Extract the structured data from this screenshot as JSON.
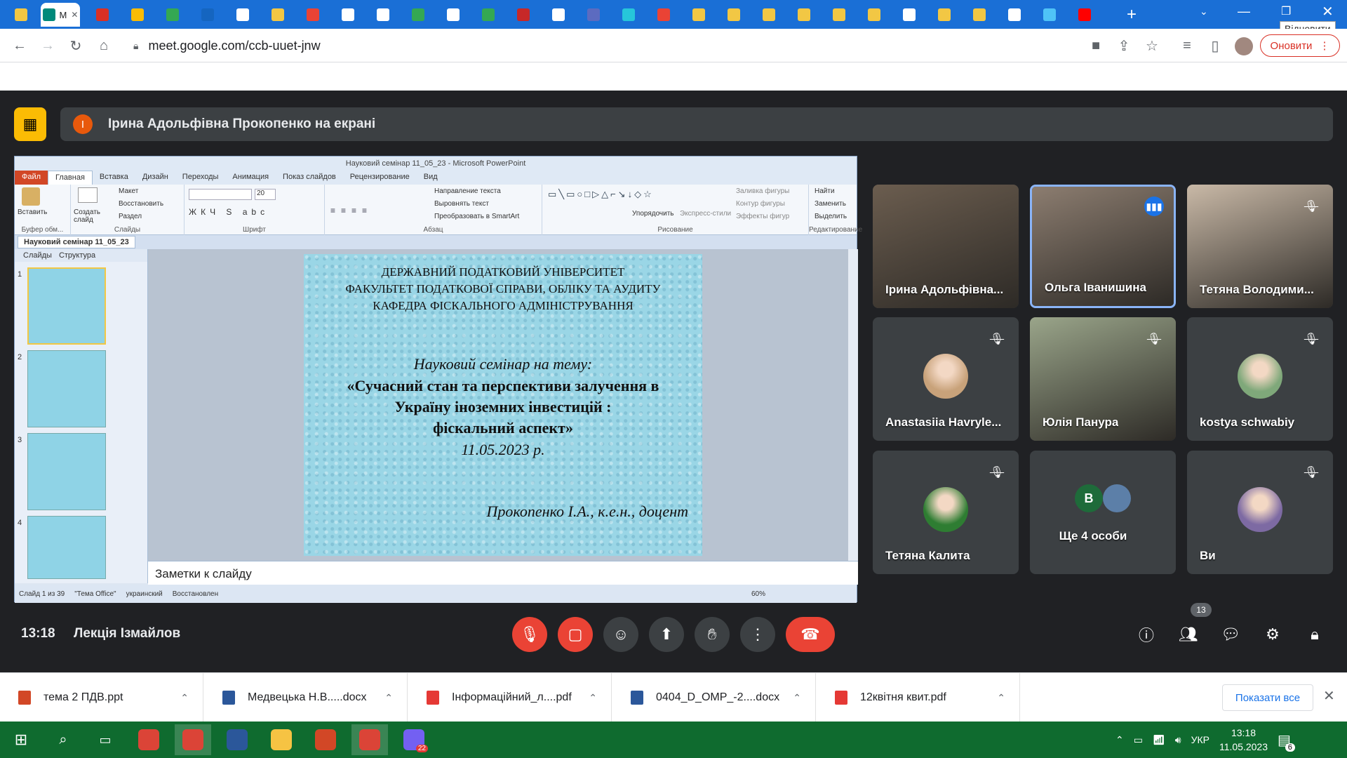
{
  "browser": {
    "tooltip": "Відновити",
    "url": "meet.google.com/ccb-uuet-jnw",
    "update_button": "Оновити",
    "tabs": [
      {
        "icon": "ukraine-crest-icon",
        "color": "#f2c744"
      },
      {
        "icon": "meet-icon",
        "color": "#00897b",
        "active": true,
        "title": "M"
      },
      {
        "icon": "globe-icon",
        "color": "#d93025"
      },
      {
        "icon": "doc-icon",
        "color": "#fbbc04"
      },
      {
        "icon": "image-icon",
        "color": "#34a853"
      },
      {
        "icon": "flag-icon",
        "color": "#1565c0"
      },
      {
        "icon": "doc-icon",
        "color": "#ffffff"
      },
      {
        "icon": "ukraine-crest-icon",
        "color": "#f2c744"
      },
      {
        "icon": "gmail-icon",
        "color": "#ea4335"
      },
      {
        "icon": "zoom-z-icon",
        "color": "#ffffff"
      },
      {
        "icon": "zoom-z-icon",
        "color": "#ffffff"
      },
      {
        "icon": "chrome-icon",
        "color": "#34a853"
      },
      {
        "icon": "zoom-z-icon",
        "color": "#ffffff"
      },
      {
        "icon": "maps-icon",
        "color": "#34a853"
      },
      {
        "icon": "shield-icon",
        "color": "#c62828"
      },
      {
        "icon": "facebook-icon",
        "color": "#ffffff"
      },
      {
        "icon": "globe-icon",
        "color": "#5c6bc0"
      },
      {
        "icon": "circle-icon",
        "color": "#26c6da"
      },
      {
        "icon": "gmail-icon",
        "color": "#ea4335"
      },
      {
        "icon": "ukraine-crest-icon",
        "color": "#f2c744"
      },
      {
        "icon": "check-icon",
        "color": "#f2c744"
      },
      {
        "icon": "ukraine-crest-icon",
        "color": "#f2c744"
      },
      {
        "icon": "ukraine-crest-icon",
        "color": "#f2c744"
      },
      {
        "icon": "ukraine-crest-icon",
        "color": "#f2c744"
      },
      {
        "icon": "ukraine-crest-icon",
        "color": "#f2c744"
      },
      {
        "icon": "notion-icon",
        "color": "#ffffff"
      },
      {
        "icon": "ukraine-crest-icon",
        "color": "#f2c744"
      },
      {
        "icon": "ukraine-crest-icon",
        "color": "#f2c744"
      },
      {
        "icon": "chart-icon",
        "color": "#ffffff"
      },
      {
        "icon": "star-icon",
        "color": "#4fc3f7"
      },
      {
        "icon": "youtube-icon",
        "color": "#ff0000"
      }
    ]
  },
  "presentation": {
    "presenter_initial": "І",
    "banner": "Ірина Адольфівна Прокопенко на екрані"
  },
  "ppt": {
    "window_title": "Науковий семінар 11_05_23 - Microsoft PowerPoint",
    "menu": [
      "Файл",
      "Главная",
      "Вставка",
      "Дизайн",
      "Переходы",
      "Анимация",
      "Показ слайдов",
      "Рецензирование",
      "Вид"
    ],
    "ribbon": {
      "paste": "Вставить",
      "new_slide": "Создать слайд",
      "layout": "Макет",
      "reset": "Восстановить",
      "section": "Раздел",
      "font_size": "20",
      "text_direction": "Направление текста",
      "align_text": "Выровнять текст",
      "smartart": "Преобразовать в SmartArt",
      "arrange": "Упорядочить",
      "quick_styles": "Экспресс-стили",
      "shape_fill": "Заливка фигуры",
      "shape_outline": "Контур фигуры",
      "shape_effects": "Эффекты фигур",
      "find": "Найти",
      "replace": "Заменить",
      "select": "Выделить",
      "groups": [
        "Буфер обм...",
        "Слайды",
        "Шрифт",
        "Абзац",
        "Рисование",
        "Редактирование"
      ]
    },
    "doc_tab": "Науковий семінар 11_05_23",
    "pane_tabs": [
      "Слайды",
      "Структура"
    ],
    "thumb_numbers": [
      "1",
      "2",
      "3",
      "4"
    ],
    "slide": {
      "org1": "ДЕРЖАВНИЙ ПОДАТКОВИЙ УНІВЕРСИТЕТ",
      "org2": "ФАКУЛЬТЕТ ПОДАТКОВОЇ СПРАВИ, ОБЛІКУ ТА АУДИТУ",
      "org3": "КАФЕДРА ФІСКАЛЬНОГО АДМІНІСТРУВАННЯ",
      "subtitle": "Науковий семінар на тему:",
      "title1": "«Сучасний стан та перспективи залучення в",
      "title2": "Україну іноземних інвестицій :",
      "title3": "фіскальний аспект»",
      "date": "11.05.2023 р.",
      "author": "Прокопенко І.А., к.е.н., доцент"
    },
    "notes": "Заметки к слайду",
    "status": [
      "Слайд 1 из 39",
      "\"Тема Office\"",
      "украинский",
      "Восстановлен"
    ],
    "zoom": "60%"
  },
  "participants": [
    {
      "name": "Ірина Адольфівна...",
      "muted": false,
      "video": true,
      "bg": "#6b5d4f"
    },
    {
      "name": "Ольга Іванишина",
      "muted": false,
      "video": true,
      "speaking": true,
      "bg": "#8c7d70"
    },
    {
      "name": "Тетяна Володими...",
      "muted": true,
      "video": true,
      "bg": "#c9b9a7"
    },
    {
      "name": "Anastasiia Havryle...",
      "muted": true,
      "video": false,
      "avatar": "#c8a27a"
    },
    {
      "name": "Юлія Панура",
      "muted": true,
      "video": true,
      "bg": "#9aa58a"
    },
    {
      "name": "kostya schwabiy",
      "muted": true,
      "video": false,
      "avatar": "#7fa87a"
    },
    {
      "name": "Тетяна Калита",
      "muted": true,
      "video": false,
      "avatar": "#2e7d32"
    },
    {
      "name": "Ще 4 особи",
      "muted": false,
      "video": false,
      "group_initial": "В"
    },
    {
      "name": "Ви",
      "muted": true,
      "video": false,
      "avatar": "#7d6aa3"
    }
  ],
  "controls": {
    "time": "13:18",
    "meeting_name": "Лекція Ізмайлов",
    "participant_count": "13"
  },
  "downloads": {
    "items": [
      {
        "name": "тема 2 ПДВ.ppt",
        "color": "#d24726"
      },
      {
        "name": "Медвецька Н.В.....docx",
        "color": "#2b579a"
      },
      {
        "name": "Інформаційний_л....pdf",
        "color": "#e53935"
      },
      {
        "name": "0404_D_OMP_-2....docx",
        "color": "#2b579a"
      },
      {
        "name": "12квітня квит.pdf",
        "color": "#e53935"
      }
    ],
    "show_all": "Показати все"
  },
  "taskbar": {
    "apps": [
      {
        "icon": "chrome-icon",
        "color": "#db4437"
      },
      {
        "icon": "chrome-icon",
        "color": "#db4437"
      },
      {
        "icon": "word-icon",
        "color": "#2b579a"
      },
      {
        "icon": "folder-icon",
        "color": "#f6c343"
      },
      {
        "icon": "powerpoint-icon",
        "color": "#d24726"
      },
      {
        "icon": "chrome-icon",
        "color": "#db4437"
      },
      {
        "icon": "viber-icon",
        "color": "#7360f2"
      }
    ],
    "viber_badge": "22",
    "lang": "УКР",
    "time": "13:18",
    "date": "11.05.2023",
    "notif_count": "6"
  }
}
